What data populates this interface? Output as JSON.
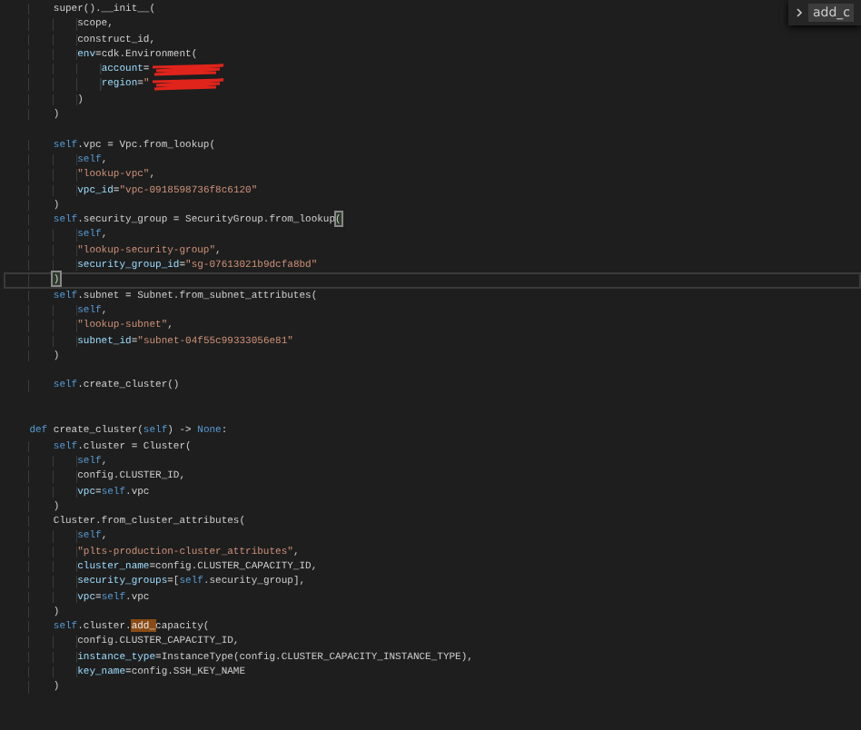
{
  "editor": {
    "lines": [
      {
        "current": false,
        "tokens": [
          {
            "kind": "plain",
            "text": "        super().__init__("
          }
        ]
      },
      {
        "current": false,
        "tokens": [
          {
            "kind": "plain",
            "text": "            scope,"
          }
        ]
      },
      {
        "current": false,
        "tokens": [
          {
            "kind": "plain",
            "text": "            construct_id,"
          }
        ]
      },
      {
        "current": false,
        "tokens": [
          {
            "kind": "param",
            "text": "            env"
          },
          {
            "kind": "plain",
            "text": "=cdk.Environment("
          }
        ]
      },
      {
        "current": false,
        "tokens": [
          {
            "kind": "param",
            "text": "                account"
          },
          {
            "kind": "plain",
            "text": "="
          },
          {
            "kind": "redacted"
          }
        ]
      },
      {
        "current": false,
        "tokens": [
          {
            "kind": "param",
            "text": "                region"
          },
          {
            "kind": "plain",
            "text": "="
          },
          {
            "kind": "string",
            "text": "\""
          },
          {
            "kind": "redacted"
          }
        ]
      },
      {
        "current": false,
        "tokens": [
          {
            "kind": "plain",
            "text": "            )"
          }
        ]
      },
      {
        "current": false,
        "tokens": [
          {
            "kind": "plain",
            "text": "        )"
          }
        ]
      },
      {
        "current": false
      },
      {
        "current": false,
        "tokens": [
          {
            "kind": "self",
            "text": "        self"
          },
          {
            "kind": "plain",
            "text": ".vpc = Vpc.from_lookup("
          }
        ]
      },
      {
        "current": false,
        "tokens": [
          {
            "kind": "self",
            "text": "            self"
          },
          {
            "kind": "plain",
            "text": ","
          }
        ]
      },
      {
        "current": false,
        "tokens": [
          {
            "kind": "string",
            "text": "            \"lookup-vpc\""
          },
          {
            "kind": "plain",
            "text": ","
          }
        ]
      },
      {
        "current": false,
        "tokens": [
          {
            "kind": "param",
            "text": "            vpc_id"
          },
          {
            "kind": "plain",
            "text": "="
          },
          {
            "kind": "string",
            "text": "\"vpc-0918598736f8c6120\""
          }
        ]
      },
      {
        "current": false,
        "tokens": [
          {
            "kind": "plain",
            "text": "        )"
          }
        ]
      },
      {
        "current": false,
        "tokens": [
          {
            "kind": "self",
            "text": "        self"
          },
          {
            "kind": "plain",
            "text": ".security_group = SecurityGroup.from_lookup"
          },
          {
            "kind": "bracket",
            "text": "("
          }
        ]
      },
      {
        "current": false,
        "tokens": [
          {
            "kind": "self",
            "text": "            self"
          },
          {
            "kind": "plain",
            "text": ","
          }
        ]
      },
      {
        "current": false,
        "tokens": [
          {
            "kind": "string",
            "text": "            \"lookup-security-group\""
          },
          {
            "kind": "plain",
            "text": ","
          }
        ]
      },
      {
        "current": false,
        "tokens": [
          {
            "kind": "param",
            "text": "            security_group_id"
          },
          {
            "kind": "plain",
            "text": "="
          },
          {
            "kind": "string",
            "text": "\"sg-07613021b9dcfa8bd\""
          }
        ]
      },
      {
        "current": true,
        "tokens": [
          {
            "kind": "bracket",
            "text": "        )"
          }
        ]
      },
      {
        "current": false,
        "tokens": [
          {
            "kind": "self",
            "text": "        self"
          },
          {
            "kind": "plain",
            "text": ".subnet = Subnet.from_subnet_attributes("
          }
        ]
      },
      {
        "current": false,
        "tokens": [
          {
            "kind": "self",
            "text": "            self"
          },
          {
            "kind": "plain",
            "text": ","
          }
        ]
      },
      {
        "current": false,
        "tokens": [
          {
            "kind": "string",
            "text": "            \"lookup-subnet\""
          },
          {
            "kind": "plain",
            "text": ","
          }
        ]
      },
      {
        "current": false,
        "tokens": [
          {
            "kind": "param",
            "text": "            subnet_id"
          },
          {
            "kind": "plain",
            "text": "="
          },
          {
            "kind": "string",
            "text": "\"subnet-04f55c99333056e81\""
          }
        ]
      },
      {
        "current": false,
        "tokens": [
          {
            "kind": "plain",
            "text": "        )"
          }
        ]
      },
      {
        "current": false
      },
      {
        "current": false,
        "tokens": [
          {
            "kind": "self",
            "text": "        self"
          },
          {
            "kind": "plain",
            "text": ".create_cluster()"
          }
        ]
      },
      {
        "current": false
      },
      {
        "current": false
      },
      {
        "current": false,
        "tokens": [
          {
            "kind": "keyword",
            "text": "    def"
          },
          {
            "kind": "plain",
            "text": " create_cluster("
          },
          {
            "kind": "self",
            "text": "self"
          },
          {
            "kind": "plain",
            "text": ") -> "
          },
          {
            "kind": "keyword",
            "text": "None"
          },
          {
            "kind": "plain",
            "text": ":"
          }
        ]
      },
      {
        "current": false,
        "tokens": [
          {
            "kind": "self",
            "text": "        self"
          },
          {
            "kind": "plain",
            "text": ".cluster = Cluster("
          }
        ]
      },
      {
        "current": false,
        "tokens": [
          {
            "kind": "self",
            "text": "            self"
          },
          {
            "kind": "plain",
            "text": ","
          }
        ]
      },
      {
        "current": false,
        "tokens": [
          {
            "kind": "plain",
            "text": "            config.CLUSTER_ID,"
          }
        ]
      },
      {
        "current": false,
        "tokens": [
          {
            "kind": "param",
            "text": "            vpc"
          },
          {
            "kind": "plain",
            "text": "="
          },
          {
            "kind": "self",
            "text": "self"
          },
          {
            "kind": "plain",
            "text": ".vpc"
          }
        ]
      },
      {
        "current": false,
        "tokens": [
          {
            "kind": "plain",
            "text": "        )"
          }
        ]
      },
      {
        "current": false,
        "tokens": [
          {
            "kind": "plain",
            "text": "        Cluster.from_cluster_attributes("
          }
        ]
      },
      {
        "current": false,
        "tokens": [
          {
            "kind": "self",
            "text": "            self"
          },
          {
            "kind": "plain",
            "text": ","
          }
        ]
      },
      {
        "current": false,
        "tokens": [
          {
            "kind": "string",
            "text": "            \"plts-production-cluster_attributes\""
          },
          {
            "kind": "plain",
            "text": ","
          }
        ]
      },
      {
        "current": false,
        "tokens": [
          {
            "kind": "param",
            "text": "            cluster_name"
          },
          {
            "kind": "plain",
            "text": "=config.CLUSTER_CAPACITY_ID,"
          }
        ]
      },
      {
        "current": false,
        "tokens": [
          {
            "kind": "param",
            "text": "            security_groups"
          },
          {
            "kind": "plain",
            "text": "=["
          },
          {
            "kind": "self",
            "text": "self"
          },
          {
            "kind": "plain",
            "text": ".security_group],"
          }
        ]
      },
      {
        "current": false,
        "tokens": [
          {
            "kind": "param",
            "text": "            vpc"
          },
          {
            "kind": "plain",
            "text": "="
          },
          {
            "kind": "self",
            "text": "self"
          },
          {
            "kind": "plain",
            "text": ".vpc"
          }
        ]
      },
      {
        "current": false,
        "tokens": [
          {
            "kind": "plain",
            "text": "        )"
          }
        ]
      },
      {
        "current": false,
        "tokens": [
          {
            "kind": "self",
            "text": "        self"
          },
          {
            "kind": "plain",
            "text": ".cluster."
          },
          {
            "kind": "match",
            "text": "add_"
          },
          {
            "kind": "plain",
            "text": "capacity("
          }
        ]
      },
      {
        "current": false,
        "tokens": [
          {
            "kind": "plain",
            "text": "            config.CLUSTER_CAPACITY_ID,"
          }
        ]
      },
      {
        "current": false,
        "tokens": [
          {
            "kind": "param",
            "text": "            instance_type"
          },
          {
            "kind": "plain",
            "text": "=InstanceType(config.CLUSTER_CAPACITY_INSTANCE_TYPE),"
          }
        ]
      },
      {
        "current": false,
        "tokens": [
          {
            "kind": "param",
            "text": "            key_name"
          },
          {
            "kind": "plain",
            "text": "=config.SSH_KEY_NAME"
          }
        ]
      },
      {
        "current": false,
        "tokens": [
          {
            "kind": "plain",
            "text": "        )"
          }
        ]
      }
    ]
  },
  "find_widget": {
    "query": "add_c"
  }
}
